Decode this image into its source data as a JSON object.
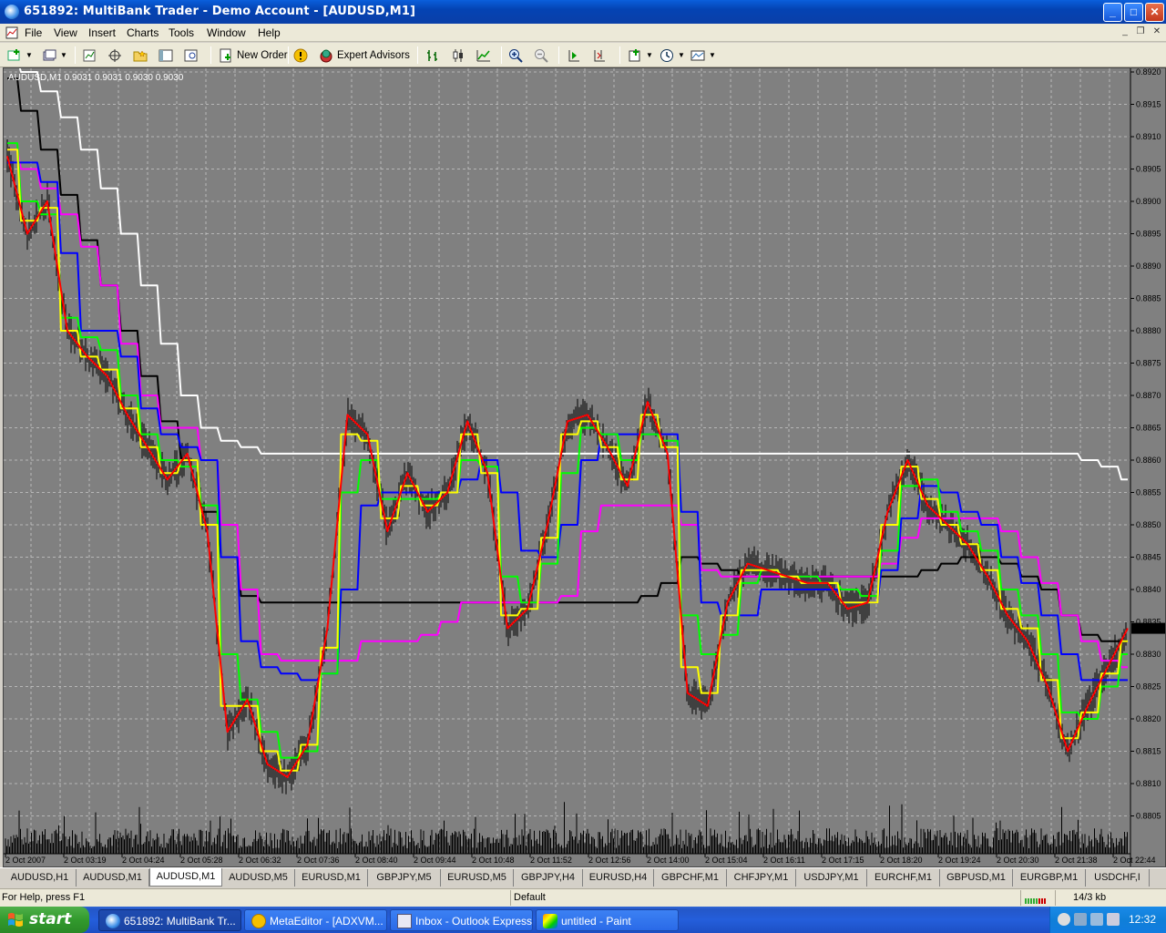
{
  "window": {
    "title": "651892: MultiBank Trader - Demo Account - [AUDUSD,M1]",
    "min_glyph": "_",
    "max_glyph": "□",
    "close_glyph": "✕"
  },
  "menu": {
    "items": [
      "File",
      "View",
      "Insert",
      "Charts",
      "Tools",
      "Window",
      "Help"
    ],
    "mdi_min": "_",
    "mdi_restore": "❐",
    "mdi_close": "✕"
  },
  "toolbar": {
    "new_order_label": "New Order",
    "expert_advisors_label": "Expert Advisors"
  },
  "chart": {
    "caption": "AUDUSD,M1  0.9031 0.9031 0.9030 0.9030",
    "colors": {
      "background": "#808080",
      "grid": "#c8c8c8",
      "candle": "#000000",
      "price": "#ff0000",
      "ma_yellow": "#ffff00",
      "ma_green": "#00ff00",
      "ma_blue": "#0000ff",
      "ma_magenta": "#ff00ff",
      "ma_black": "#000000",
      "ma_white": "#ffffff",
      "volume": "#000000"
    }
  },
  "chart_data": {
    "type": "line",
    "title": "AUDUSD,M1",
    "ylim": [
      0.8802,
      0.8922
    ],
    "y_ticks": [
      "0.8920",
      "0.8915",
      "0.8910",
      "0.8905",
      "0.8900",
      "0.8895",
      "0.8890",
      "0.8885",
      "0.8880",
      "0.8875",
      "0.8870",
      "0.8865",
      "0.8860",
      "0.8855",
      "0.8850",
      "0.8845",
      "0.8840",
      "0.8835",
      "0.8830",
      "0.8825",
      "0.8820",
      "0.8815",
      "0.8810",
      "0.8805"
    ],
    "x_ticks": [
      "2 Oct 2007",
      "2 Oct 03:19",
      "2 Oct 04:24",
      "2 Oct 05:28",
      "2 Oct 06:32",
      "2 Oct 07:36",
      "2 Oct 08:40",
      "2 Oct 09:44",
      "2 Oct 10:48",
      "2 Oct 11:52",
      "2 Oct 12:56",
      "2 Oct 14:00",
      "2 Oct 15:04",
      "2 Oct 16:11",
      "2 Oct 17:15",
      "2 Oct 18:20",
      "2 Oct 19:24",
      "2 Oct 20:30",
      "2 Oct 21:38",
      "2 Oct 22:44"
    ],
    "grid": true,
    "series": [
      {
        "color": "#ff0000",
        "values": [
          0.8907,
          0.8895,
          0.89,
          0.888,
          0.8876,
          0.8873,
          0.8867,
          0.8862,
          0.8857,
          0.8861,
          0.8849,
          0.8818,
          0.8823,
          0.8813,
          0.8811,
          0.8816,
          0.8834,
          0.8867,
          0.8864,
          0.8849,
          0.8858,
          0.8852,
          0.8855,
          0.8866,
          0.8858,
          0.8834,
          0.8837,
          0.885,
          0.8866,
          0.8867,
          0.8862,
          0.8856,
          0.8869,
          0.8861,
          0.8824,
          0.8822,
          0.8838,
          0.8844,
          0.8843,
          0.8842,
          0.8841,
          0.8841,
          0.8837,
          0.8838,
          0.8852,
          0.886,
          0.8853,
          0.885,
          0.8847,
          0.8842,
          0.8836,
          0.8832,
          0.8825,
          0.8815,
          0.8822,
          0.8828,
          0.8834
        ]
      },
      {
        "color": "#ffff00",
        "values": [
          0.8908,
          0.8897,
          0.8899,
          0.888,
          0.8876,
          0.8874,
          0.8868,
          0.8862,
          0.8858,
          0.886,
          0.885,
          0.8822,
          0.8822,
          0.8815,
          0.8812,
          0.8816,
          0.8831,
          0.8864,
          0.8863,
          0.8851,
          0.8856,
          0.8853,
          0.8855,
          0.8864,
          0.8858,
          0.8836,
          0.8837,
          0.8848,
          0.8864,
          0.8866,
          0.8862,
          0.8857,
          0.8867,
          0.8862,
          0.8828,
          0.8824,
          0.8836,
          0.8843,
          0.8843,
          0.8842,
          0.8841,
          0.8841,
          0.8838,
          0.8838,
          0.885,
          0.8859,
          0.8854,
          0.885,
          0.8847,
          0.8843,
          0.8837,
          0.8834,
          0.8826,
          0.8817,
          0.8821,
          0.8827,
          0.8832
        ]
      },
      {
        "color": "#00ff00",
        "values": [
          0.8909,
          0.89,
          0.8898,
          0.8882,
          0.8879,
          0.8877,
          0.887,
          0.8864,
          0.886,
          0.8859,
          0.8853,
          0.883,
          0.8823,
          0.8818,
          0.8814,
          0.8815,
          0.8827,
          0.8855,
          0.886,
          0.8854,
          0.8854,
          0.8854,
          0.8855,
          0.886,
          0.8859,
          0.8842,
          0.8838,
          0.8844,
          0.8858,
          0.8865,
          0.8864,
          0.886,
          0.8864,
          0.8863,
          0.8836,
          0.883,
          0.8833,
          0.8841,
          0.8843,
          0.8842,
          0.8842,
          0.8841,
          0.884,
          0.8839,
          0.8846,
          0.8856,
          0.8857,
          0.8852,
          0.8849,
          0.8846,
          0.884,
          0.8836,
          0.883,
          0.8821,
          0.882,
          0.8825,
          0.883
        ]
      },
      {
        "color": "#0000ff",
        "values": [
          0.8906,
          0.8906,
          0.8903,
          0.8892,
          0.888,
          0.888,
          0.8876,
          0.8868,
          0.8864,
          0.8862,
          0.886,
          0.8845,
          0.8832,
          0.8828,
          0.8827,
          0.8826,
          0.8827,
          0.884,
          0.8853,
          0.8855,
          0.8855,
          0.8855,
          0.8855,
          0.8857,
          0.886,
          0.8855,
          0.8846,
          0.8845,
          0.885,
          0.886,
          0.8864,
          0.8864,
          0.8864,
          0.8864,
          0.8852,
          0.8838,
          0.8836,
          0.8836,
          0.884,
          0.884,
          0.884,
          0.884,
          0.8838,
          0.8838,
          0.8843,
          0.8851,
          0.8856,
          0.8855,
          0.8852,
          0.885,
          0.8845,
          0.8841,
          0.8836,
          0.883,
          0.8826,
          0.8826,
          0.8826
        ]
      },
      {
        "color": "#ff00ff",
        "values": [
          0.8908,
          0.8905,
          0.8902,
          0.8898,
          0.8893,
          0.8887,
          0.8878,
          0.887,
          0.8865,
          0.8865,
          0.886,
          0.885,
          0.884,
          0.883,
          0.8829,
          0.8829,
          0.8829,
          0.8829,
          0.8832,
          0.8832,
          0.8832,
          0.8833,
          0.8835,
          0.8838,
          0.8838,
          0.8838,
          0.8838,
          0.8838,
          0.8839,
          0.8849,
          0.8853,
          0.8853,
          0.8853,
          0.8853,
          0.885,
          0.8843,
          0.8842,
          0.8842,
          0.8842,
          0.8842,
          0.8842,
          0.8842,
          0.8842,
          0.8842,
          0.8844,
          0.8848,
          0.8851,
          0.8851,
          0.8851,
          0.8851,
          0.8849,
          0.8845,
          0.8841,
          0.8836,
          0.8832,
          0.8829,
          0.8828
        ]
      },
      {
        "color": "#000000",
        "values": [
          0.8919,
          0.8914,
          0.8908,
          0.8901,
          0.8894,
          0.8887,
          0.888,
          0.8873,
          0.8866,
          0.886,
          0.8852,
          0.8845,
          0.8839,
          0.8838,
          0.8838,
          0.8838,
          0.8838,
          0.8838,
          0.8838,
          0.8838,
          0.8838,
          0.8838,
          0.8838,
          0.8838,
          0.8838,
          0.8838,
          0.8838,
          0.8838,
          0.8838,
          0.8838,
          0.8838,
          0.8838,
          0.8839,
          0.8841,
          0.8845,
          0.8844,
          0.8843,
          0.8842,
          0.8842,
          0.8842,
          0.8842,
          0.8842,
          0.8842,
          0.8842,
          0.8842,
          0.8842,
          0.8843,
          0.8844,
          0.8845,
          0.8845,
          0.8844,
          0.8842,
          0.884,
          0.8836,
          0.8833,
          0.8832,
          0.8832
        ]
      },
      {
        "color": "#ffffff",
        "values": [
          0.8922,
          0.892,
          0.8917,
          0.8913,
          0.8908,
          0.8902,
          0.8895,
          0.8887,
          0.8878,
          0.887,
          0.8865,
          0.8863,
          0.8862,
          0.8861,
          0.8861,
          0.8861,
          0.8861,
          0.8861,
          0.8861,
          0.8861,
          0.8861,
          0.8861,
          0.8861,
          0.8861,
          0.8861,
          0.8861,
          0.8861,
          0.8861,
          0.8861,
          0.8861,
          0.8861,
          0.8861,
          0.8861,
          0.8861,
          0.8861,
          0.8861,
          0.8861,
          0.8861,
          0.8861,
          0.8861,
          0.8861,
          0.8861,
          0.8861,
          0.8861,
          0.8861,
          0.8861,
          0.8861,
          0.8861,
          0.8861,
          0.8861,
          0.8861,
          0.8861,
          0.8861,
          0.8861,
          0.886,
          0.8859,
          0.8857
        ]
      }
    ]
  },
  "tabs": [
    "AUDUSD,H1",
    "AUDUSD,M1",
    "AUDUSD,M1",
    "AUDUSD,M5",
    "EURUSD,M1",
    "GBPJPY,M5",
    "EURUSD,M5",
    "GBPJPY,H4",
    "EURUSD,H4",
    "GBPCHF,M1",
    "CHFJPY,M1",
    "USDJPY,M1",
    "EURCHF,M1",
    "GBPUSD,M1",
    "EURGBP,M1",
    "USDCHF,I"
  ],
  "active_tab_index": 2,
  "statusbar": {
    "help": "For Help, press F1",
    "profile": "Default",
    "traffic": "14/3 kb"
  },
  "taskbar": {
    "start_label": "start",
    "tasks": [
      "651892: MultiBank Tr...",
      "MetaEditor - [ADXVM...",
      "Inbox - Outlook Express",
      "untitled - Paint"
    ],
    "clock": "12:32"
  }
}
